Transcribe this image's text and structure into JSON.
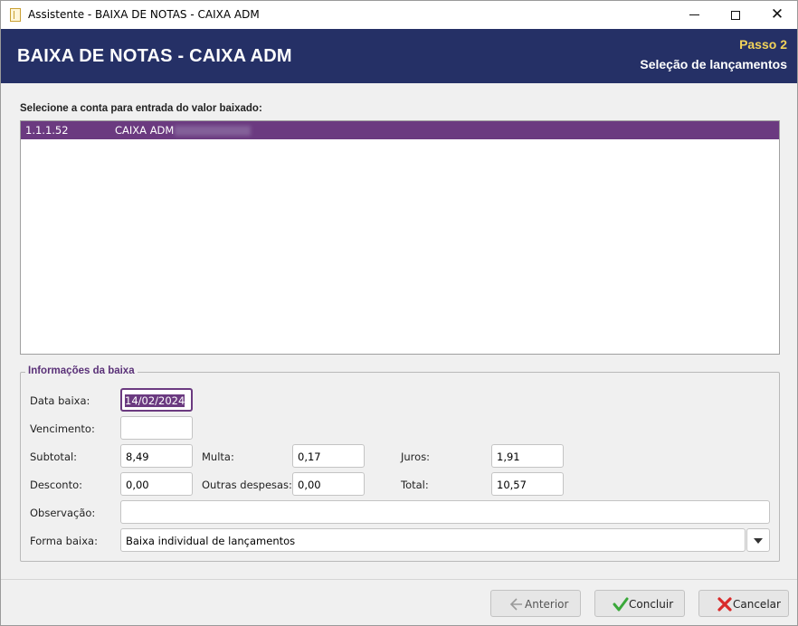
{
  "window": {
    "title": "Assistente - BAIXA DE NOTAS - CAIXA ADM"
  },
  "header": {
    "title": "BAIXA DE NOTAS - CAIXA ADM",
    "step": "Passo 2",
    "step_description": "Seleção de lançamentos"
  },
  "account_selection": {
    "label": "Selecione a conta para entrada do valor baixado:",
    "rows": [
      {
        "code": "1.1.1.52",
        "name": "CAIXA ADM",
        "selected": true
      }
    ]
  },
  "details": {
    "group_title": "Informações da baixa",
    "data_baixa": {
      "label": "Data baixa:",
      "value": "14/02/2024"
    },
    "vencimento": {
      "label": "Vencimento:",
      "value": ""
    },
    "subtotal": {
      "label": "Subtotal:",
      "value": "8,49"
    },
    "multa": {
      "label": "Multa:",
      "value": "0,17"
    },
    "juros": {
      "label": "Juros:",
      "value": "1,91"
    },
    "desconto": {
      "label": "Desconto:",
      "value": "0,00"
    },
    "outras_despesas": {
      "label": "Outras despesas:",
      "value": "0,00"
    },
    "total": {
      "label": "Total:",
      "value": "10,57"
    },
    "observacao": {
      "label": "Observação:",
      "value": ""
    },
    "forma_baixa": {
      "label": "Forma baixa:",
      "value": "Baixa individual de lançamentos"
    }
  },
  "buttons": {
    "previous": "Anterior",
    "finish": "Concluir",
    "cancel": "Cancelar"
  },
  "colors": {
    "banner": "#253066",
    "step": "#f2d35a",
    "selection": "#6b3a80",
    "group_title": "#5a3178"
  }
}
